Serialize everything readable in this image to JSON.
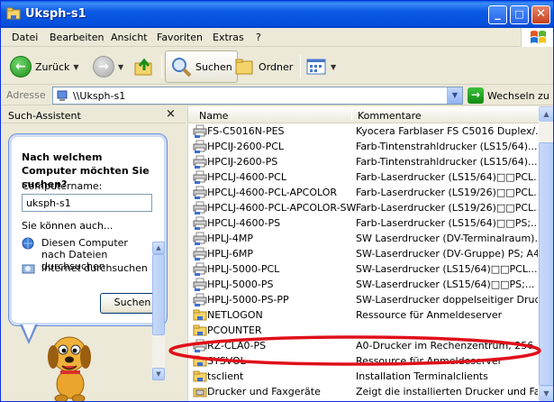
{
  "window": {
    "title": "Uksph-s1",
    "buttons": {
      "min": "_",
      "max": "□",
      "close": "✕"
    }
  },
  "menu": [
    "Datei",
    "Bearbeiten",
    "Ansicht",
    "Favoriten",
    "Extras",
    "?"
  ],
  "toolbar": {
    "back_label": "Zurück",
    "search_label": "Suchen",
    "folders_label": "Ordner"
  },
  "address": {
    "label": "Adresse",
    "value": "\\\\Uksph-s1",
    "go_label": "Wechseln zu"
  },
  "assistant": {
    "title": "Such-Assistent",
    "heading": "Nach welchem Computer möchten Sie suchen?",
    "computer_label": "Computername:",
    "computer_value": "uksph-s1",
    "also_label": "Sie können auch...",
    "options": [
      {
        "icon": "network-search-icon",
        "text": "Diesen Computer nach Dateien durchsuchen"
      },
      {
        "icon": "internet-search-icon",
        "text": "Internet durchsuchen"
      }
    ],
    "search_button": "Suchen"
  },
  "columns": {
    "name": "Name",
    "comment": "Kommentare"
  },
  "files": [
    {
      "icon": "printer",
      "name": "FS-C5016N-PES",
      "comment": "Kyocera Farblaser FS C5016 Duplex/..."
    },
    {
      "icon": "printer",
      "name": "HPCIJ-2600-PCL",
      "comment": "Farb-Tintenstrahldrucker (LS15/64)..."
    },
    {
      "icon": "printer",
      "name": "HPCIJ-2600-PS",
      "comment": "Farb-Tintenstrahldrucker (LS15/64)..."
    },
    {
      "icon": "printer",
      "name": "HPCLJ-4600-PCL",
      "comment": "Farb-Laserdrucker (LS15/64)□□PCL..."
    },
    {
      "icon": "printer",
      "name": "HPCLJ-4600-PCL-APCOLOR",
      "comment": "Farb-Laserdrucker (LS19/26)□□PCL..."
    },
    {
      "icon": "printer",
      "name": "HPCLJ-4600-PCL-APCOLOR-SW",
      "comment": "Farb-Laserdrucker (LS19/26)□□PCL..."
    },
    {
      "icon": "printer",
      "name": "HPCLJ-4600-PS",
      "comment": "Farb-Laserdrucker (LS15/64)□□PS;..."
    },
    {
      "icon": "printer",
      "name": "HPLJ-4MP",
      "comment": "SW Laserdrucker (DV-Terminalraum)..."
    },
    {
      "icon": "printer",
      "name": "HPLJ-6MP",
      "comment": "SW-Laserdrucker (DV-Gruppe) PS; A4"
    },
    {
      "icon": "printer",
      "name": "HPLJ-5000-PCL",
      "comment": "SW-Laserdrucker (LS15/64)□□PCL..."
    },
    {
      "icon": "printer",
      "name": "HPLJ-5000-PS",
      "comment": "SW-Laserdrucker (LS15/64)□□PS;..."
    },
    {
      "icon": "printer",
      "name": "HPLJ-5000-PS-PP",
      "comment": "SW-Laserdrucker doppelseitiger Druc..."
    },
    {
      "icon": "folder",
      "name": "NETLOGON",
      "comment": "Ressource für Anmeldeserver"
    },
    {
      "icon": "folder",
      "name": "PCOUNTER",
      "comment": ""
    },
    {
      "icon": "printer",
      "name": "RZ-CLA0-PS",
      "comment": "A0-Drucker im Rechenzentrum, 256 ..."
    },
    {
      "icon": "folder",
      "name": "SYSVOL",
      "comment": "Ressource für Anmeldeserver"
    },
    {
      "icon": "folder",
      "name": "tsclient",
      "comment": "Installation Terminalclients"
    },
    {
      "icon": "printers-folder",
      "name": "Drucker und Faxgeräte",
      "comment": "Zeigt die installierten Drucker und Fa..."
    }
  ],
  "colors": {
    "title_blue": "#0550dd",
    "ellipse_red": "#e0101a"
  }
}
